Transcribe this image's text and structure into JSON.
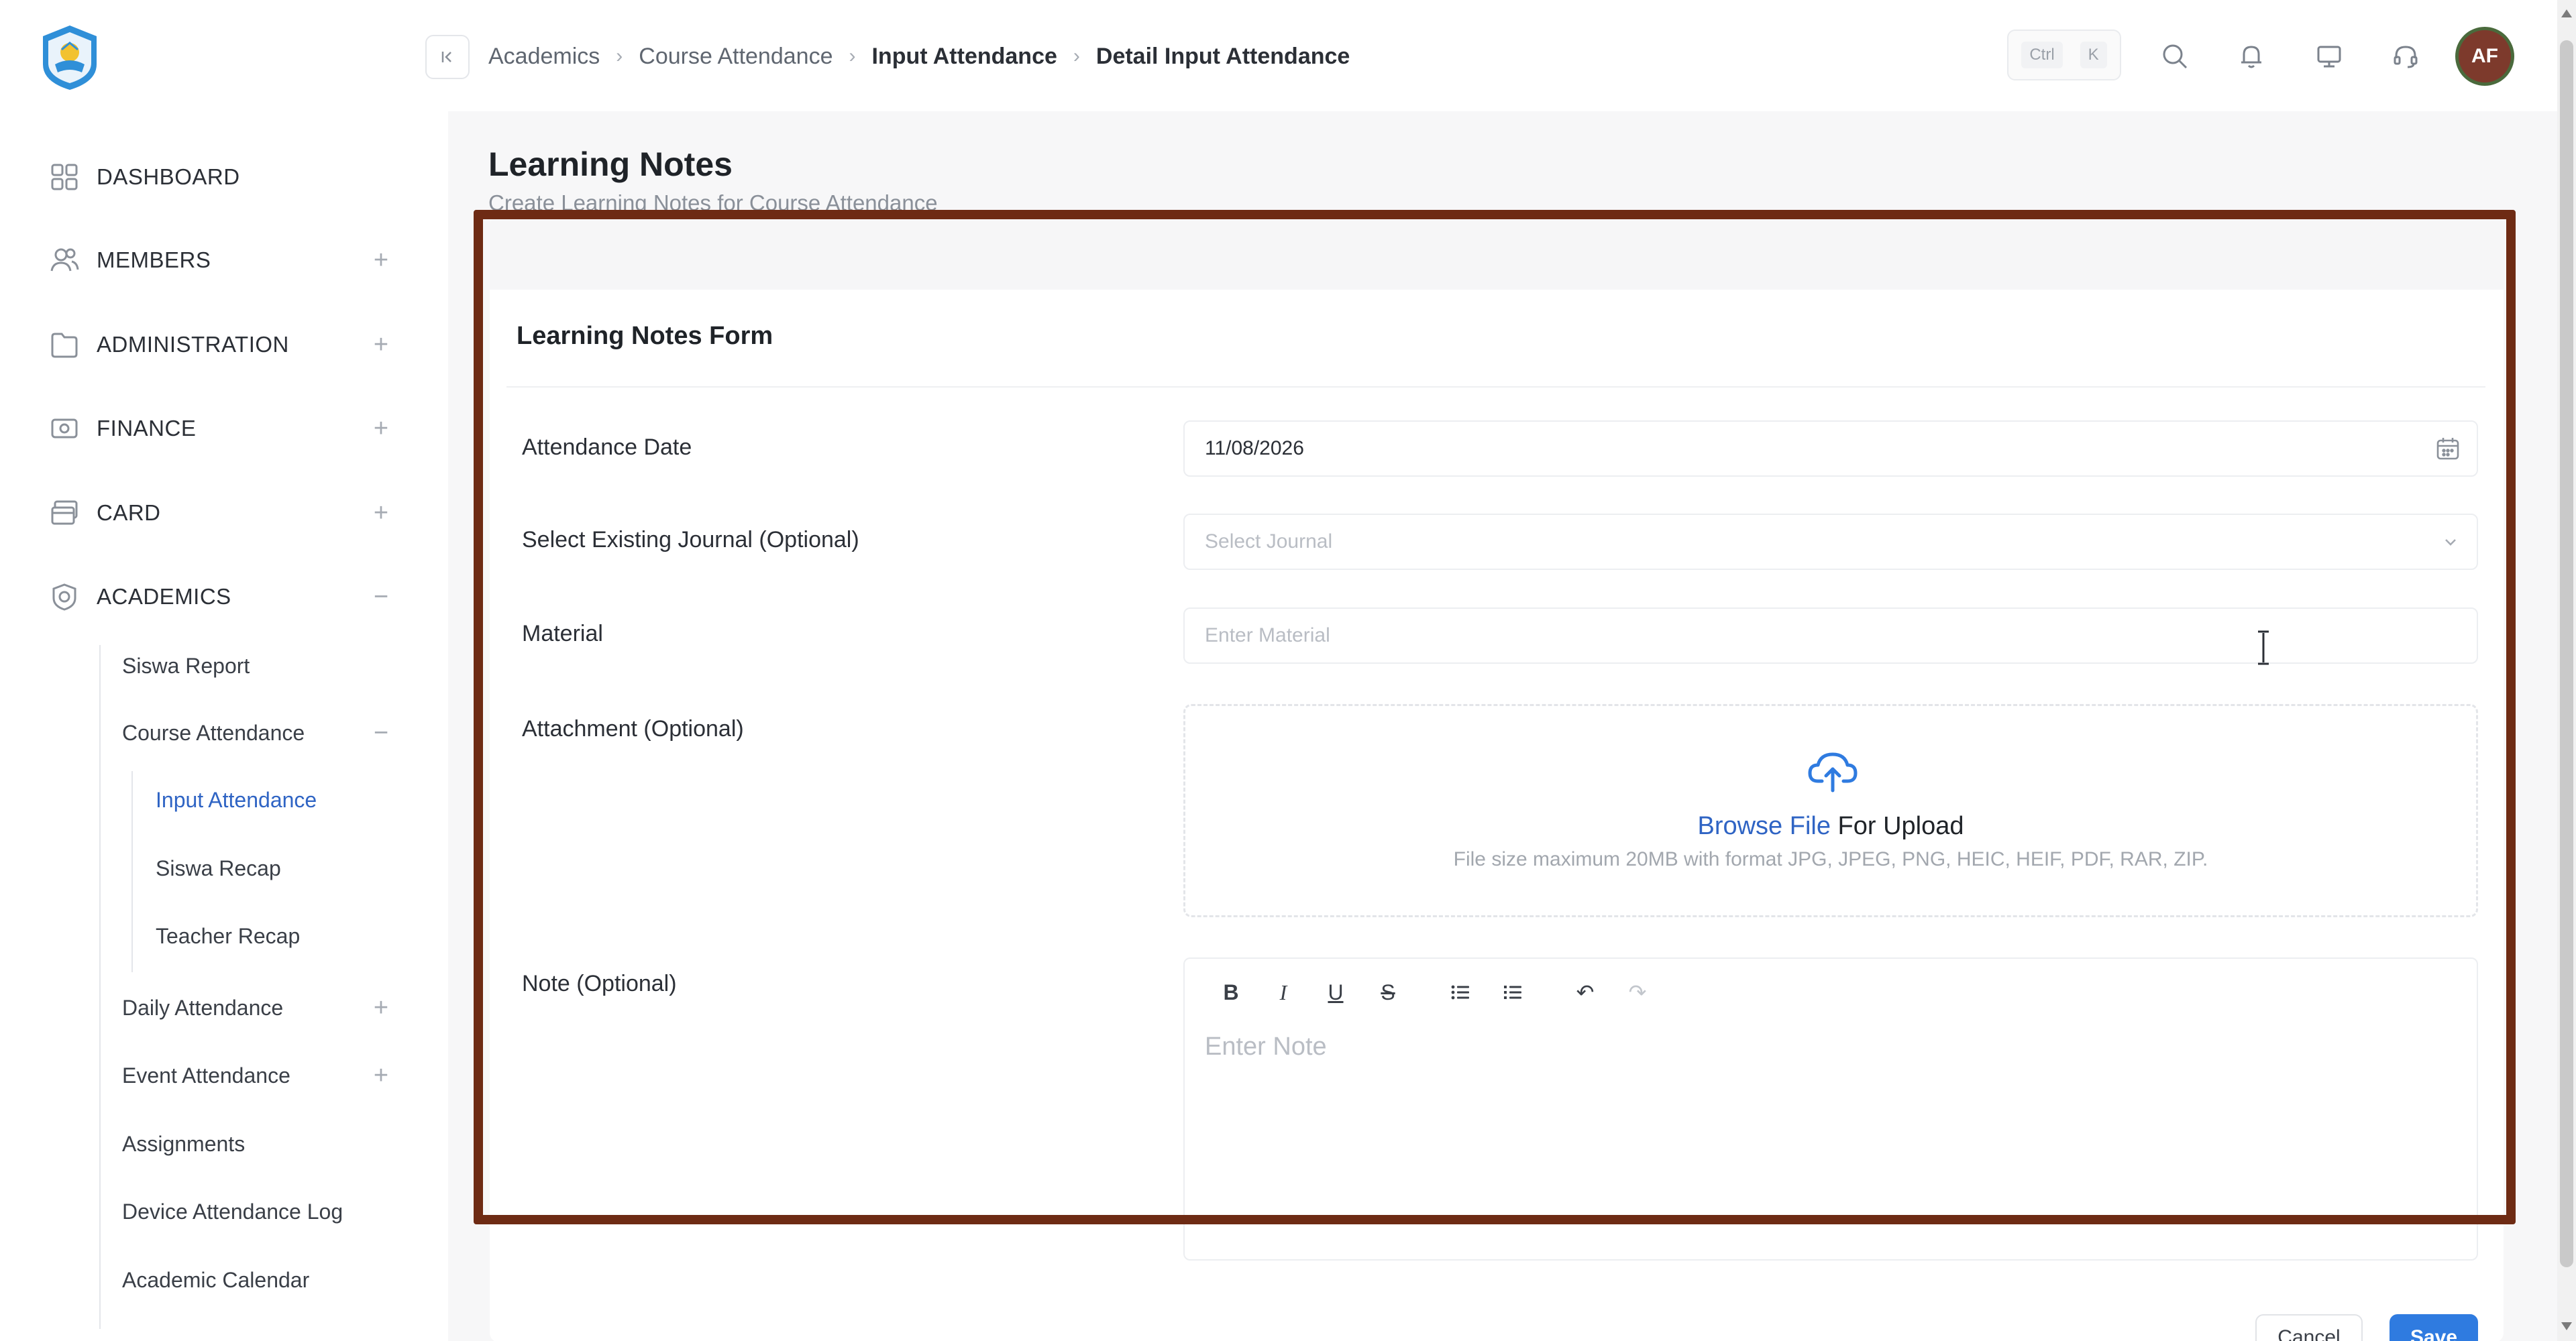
{
  "app": {
    "logo_name": "school-emblem",
    "accent_color": "#2f64c4",
    "highlight_color": "#6e2b14"
  },
  "sidebar": {
    "items": [
      {
        "label": "DASHBOARD",
        "icon": "grid-icon",
        "toggle": ""
      },
      {
        "label": "MEMBERS",
        "icon": "users-icon",
        "toggle": "+"
      },
      {
        "label": "ADMINISTRATION",
        "icon": "folder-icon",
        "toggle": "+"
      },
      {
        "label": "FINANCE",
        "icon": "money-icon",
        "toggle": "+"
      },
      {
        "label": "CARD",
        "icon": "card-icon",
        "toggle": "+"
      },
      {
        "label": "ACADEMICS",
        "icon": "badge-icon",
        "toggle": "−"
      }
    ],
    "academics_sub": [
      {
        "label": "Siswa Report",
        "toggle": ""
      },
      {
        "label": "Course Attendance",
        "toggle": "−"
      },
      {
        "label": "Daily Attendance",
        "toggle": "+"
      },
      {
        "label": "Event Attendance",
        "toggle": "+"
      },
      {
        "label": "Assignments",
        "toggle": ""
      },
      {
        "label": "Device Attendance Log",
        "toggle": ""
      },
      {
        "label": "Academic Calendar",
        "toggle": ""
      }
    ],
    "course_attendance_sub": [
      {
        "label": "Input Attendance",
        "active": true
      },
      {
        "label": "Siswa Recap",
        "active": false
      },
      {
        "label": "Teacher Recap",
        "active": false
      }
    ]
  },
  "topbar": {
    "breadcrumb": [
      "Academics",
      "Course Attendance",
      "Input Attendance",
      "Detail Input Attendance"
    ],
    "shortcut_keys": [
      "Ctrl",
      "K"
    ],
    "avatar_initials": "AF"
  },
  "page": {
    "title": "Learning Notes",
    "subtitle": "Create Learning Notes for Course Attendance"
  },
  "form": {
    "title": "Learning Notes Form",
    "attendance_date": {
      "label": "Attendance Date",
      "value": "11/08/2026"
    },
    "journal": {
      "label": "Select Existing Journal (Optional)",
      "placeholder": "Select Journal"
    },
    "material": {
      "label": "Material",
      "placeholder": "Enter Material"
    },
    "attachment": {
      "label": "Attachment (Optional)",
      "browse_link": "Browse File",
      "browse_suffix": " For Upload",
      "hint": "File size maximum 20MB with format JPG, JPEG, PNG, HEIC, HEIF, PDF, RAR, ZIP."
    },
    "note": {
      "label": "Note (Optional)",
      "placeholder": "Enter Note"
    },
    "toolbar": {
      "bold": "B",
      "italic": "I",
      "underline": "U",
      "strike": "S",
      "undo": "↶",
      "redo": "↷"
    },
    "cancel_label": "Cancel",
    "save_label": "Save"
  }
}
